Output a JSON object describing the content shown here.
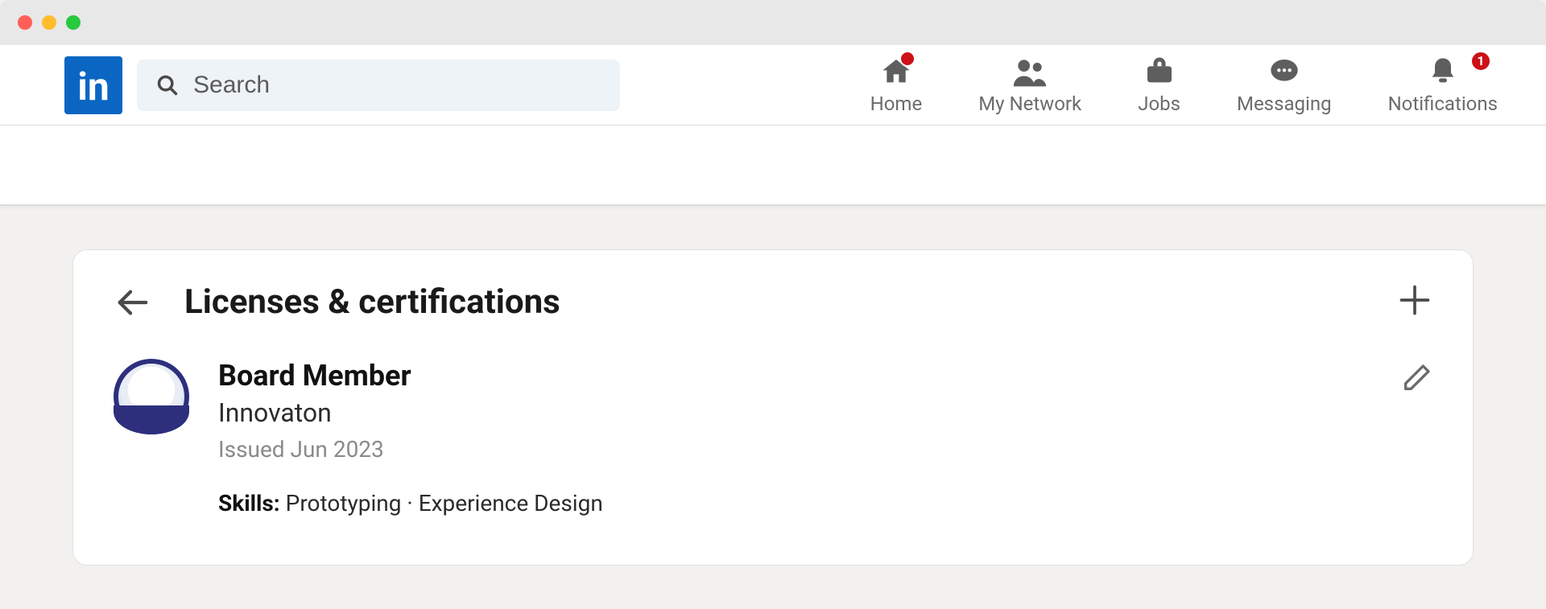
{
  "window": {
    "traffic_lights": [
      "close",
      "minimize",
      "zoom"
    ]
  },
  "logo_text": "in",
  "search": {
    "placeholder": "Search"
  },
  "nav": {
    "items": [
      {
        "key": "home",
        "label": "Home",
        "badge": ""
      },
      {
        "key": "network",
        "label": "My Network"
      },
      {
        "key": "jobs",
        "label": "Jobs"
      },
      {
        "key": "messaging",
        "label": "Messaging"
      },
      {
        "key": "notifications",
        "label": "Notifications",
        "badge": "1"
      }
    ]
  },
  "section": {
    "title": "Licenses & certifications",
    "items": [
      {
        "title": "Board Member",
        "org": "Innovaton",
        "issued": "Issued Jun 2023",
        "skills_label": "Skills:",
        "skills_value": "Prototyping · Experience Design"
      }
    ]
  }
}
